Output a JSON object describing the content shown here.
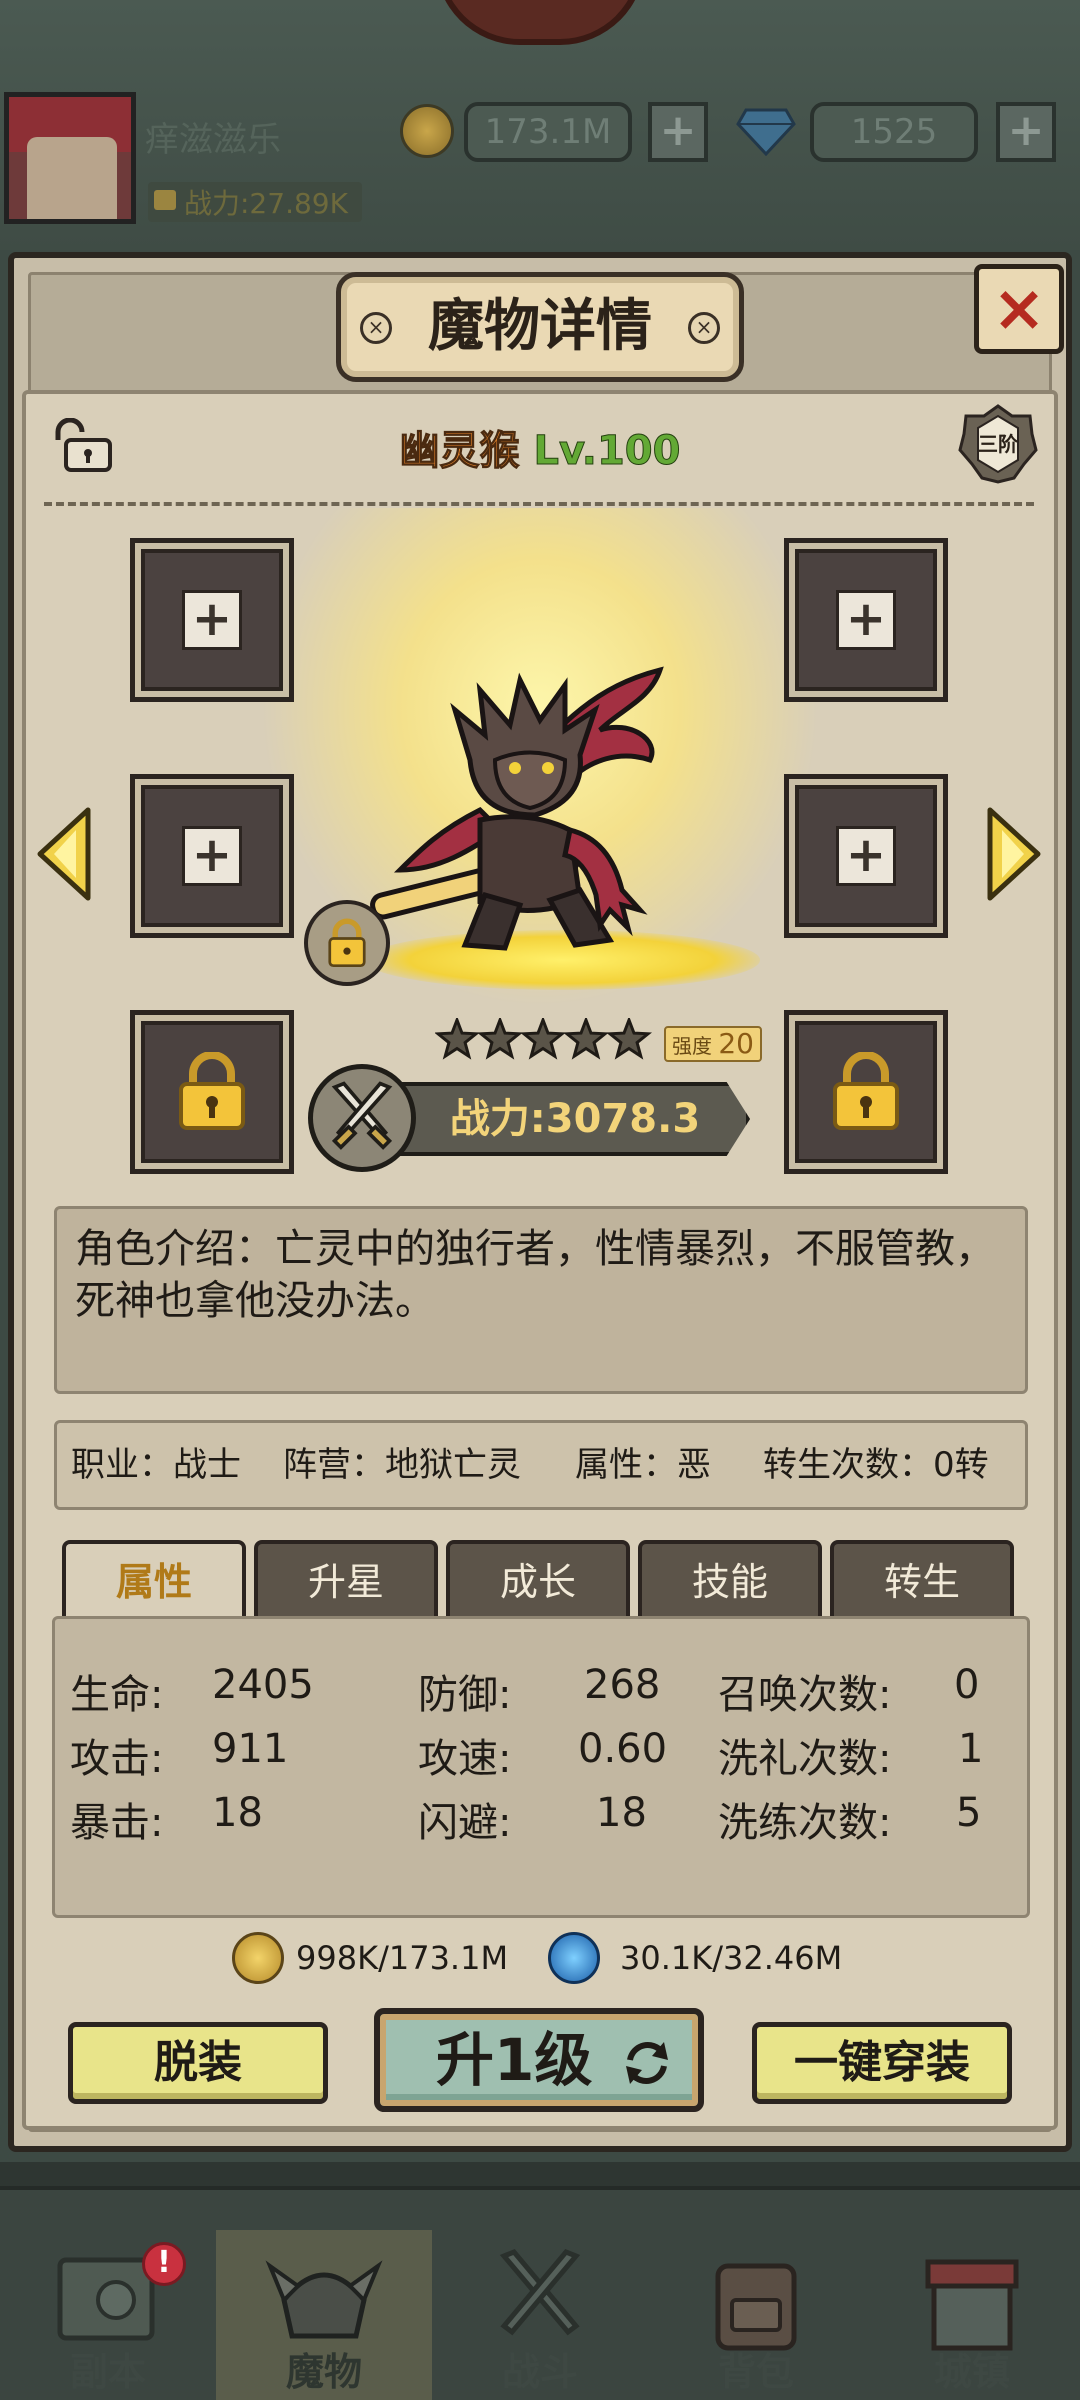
{
  "top_bar": {
    "player_name": "痒滋滋乐",
    "power": "战力:27.89K",
    "gold": "173.1M",
    "gems": "1525"
  },
  "panel": {
    "title": "魔物详情",
    "close_icon": "close-icon"
  },
  "monster": {
    "name": "幽灵猴",
    "level": "Lv.100",
    "rank": "三阶",
    "stars": 5,
    "strength_label": "强度",
    "strength_value": "20",
    "power": "战力:3078.3"
  },
  "description": "角色介绍：亡灵中的独行者，性情暴烈，不服管教，死神也拿他没办法。",
  "info": {
    "job": "职业：战士",
    "faction": "阵营：地狱亡灵",
    "attribute": "属性：恶",
    "rebirths": "转生次数：0转"
  },
  "tabs": [
    "属性",
    "升星",
    "成长",
    "技能",
    "转生"
  ],
  "stats": {
    "hp_label": "生命:",
    "hp": "2405",
    "atk_label": "攻击:",
    "atk": "911",
    "crit_label": "暴击:",
    "crit": "18",
    "def_label": "防御:",
    "def": "268",
    "speed_label": "攻速:",
    "speed": "0.60",
    "dodge_label": "闪避:",
    "dodge": "18",
    "summon_label": "召唤次数:",
    "summon": "0",
    "baptism_label": "洗礼次数:",
    "baptism": "1",
    "refine_label": "洗练次数:",
    "refine": "5"
  },
  "costs": {
    "gold": "998K/173.1M",
    "essence": "30.1K/32.46M"
  },
  "buttons": {
    "unequip": "脱装",
    "level_up": "升1级",
    "equip_all": "一键穿装"
  },
  "nav": {
    "items": [
      "副本",
      "魔物",
      "战斗",
      "背包",
      "城镇"
    ],
    "active": "魔物",
    "notice": "!"
  },
  "colors": {
    "accent_gold": "#f3d47a",
    "name_orange": "#e2822a",
    "level_green": "#63a935",
    "close_red": "#b52b20",
    "button_yellow": "#e8e48a"
  }
}
